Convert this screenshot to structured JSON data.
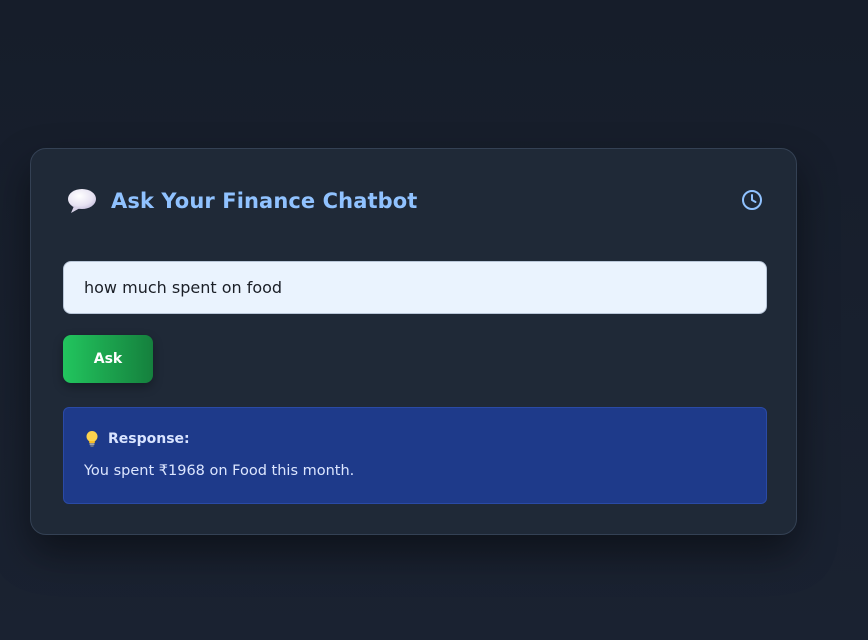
{
  "chatbot": {
    "title": "Ask Your Finance Chatbot",
    "title_icon": "speech-bubble-icon",
    "history_icon": "clock-icon"
  },
  "query": {
    "value": "how much spent on food"
  },
  "ask_button": {
    "label": "Ask"
  },
  "response": {
    "icon": "lightbulb-icon",
    "label": "Response:",
    "text": "You spent ₹1968 on Food this month."
  },
  "colors": {
    "background": "#161d2a",
    "card": "#1f2937",
    "title": "#90c2ff",
    "input_bg": "#eaf3fe",
    "button_start": "#22c55e",
    "button_end": "#15803d",
    "response_bg": "#1e3a8a"
  }
}
